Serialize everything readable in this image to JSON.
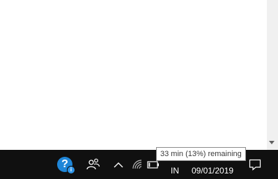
{
  "taskbar": {
    "input_language": "IN",
    "date": "09/01/2019"
  },
  "tooltip": {
    "battery_text": "33 min (13%) remaining"
  },
  "colors": {
    "taskbar_bg": "#101010",
    "help_icon_blue": "#1f86d8",
    "tooltip_border": "#8c8c8c"
  },
  "icons": [
    "help-icon",
    "people-icon",
    "chevron-up-icon",
    "wifi-icon",
    "battery-icon",
    "notification-icon"
  ]
}
